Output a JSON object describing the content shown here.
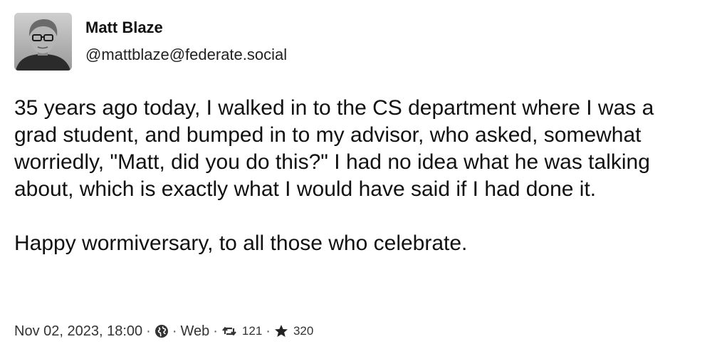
{
  "author": {
    "display_name": "Matt Blaze",
    "handle": "@mattblaze@federate.social",
    "avatar_icon": "avatar-photo"
  },
  "post": {
    "paragraphs": [
      "35 years ago today, I walked in to the CS department where I was a grad student, and bumped in to my advisor, who asked, somewhat worriedly, \"Matt, did you do this?\" I had no idea what he was talking about, which is exactly what I would have said if I had done it.",
      "Happy wormiversary, to all those who celebrate."
    ]
  },
  "meta": {
    "timestamp": "Nov 02, 2023, 18:00",
    "separator": "·",
    "visibility_icon": "globe-icon",
    "client": "Web",
    "boost_icon": "boost-icon",
    "boosts": "121",
    "favourite_icon": "star-icon",
    "favourites": "320"
  },
  "colors": {
    "text": "#111111",
    "meta_text": "#333333",
    "background": "#ffffff"
  }
}
